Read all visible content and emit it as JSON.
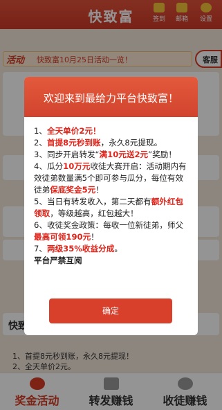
{
  "header": {
    "title": "快致富",
    "sign_label": "签到",
    "mail_label": "邮箱",
    "settings_label": "设置"
  },
  "notice": {
    "tag": "活动",
    "text": "快致富10月25日活动一览！",
    "side_button": "客服"
  },
  "modal": {
    "title": "欢迎来到最给力平台快致富！",
    "items": [
      {
        "prefix": "1、",
        "red": "全天单价2元！",
        "rest": ""
      },
      {
        "prefix": "2、",
        "red": "首提8元秒到账",
        "rest": "，永久8元提现。"
      },
      {
        "prefix": "3、同步开启转发“",
        "red": "满10元送2元",
        "rest": "”奖励！"
      },
      {
        "prefix": "4、瓜分",
        "red": "10万元",
        "rest": "收徒大赛开启：活动期内有效徒弟数量满5个即可参与瓜分，每位有效徒弟"
      },
      {
        "prefix": "5、当日有转发收入，第二天都有",
        "red": "额外红包领取",
        "rest": "，等级越高，红包越大！"
      },
      {
        "prefix": "6、收徒奖金政策：每收一位新徒弟，师父",
        "red": "最高可领190元",
        "rest": "！"
      },
      {
        "prefix": "7、",
        "red": "两级35%收益分成",
        "rest": "。"
      }
    ],
    "item4_tail_red": "保底奖金5元",
    "item4_tail": "！",
    "footer_note": "平台严禁互阅",
    "confirm_label": "确定"
  },
  "bottom": {
    "section_label": "快致富",
    "lines": [
      "1、首提8元秒到账，永久8元提现！",
      "2、全天单价2元。"
    ]
  },
  "tabs": [
    {
      "label": "奖金活动"
    },
    {
      "label": "转发赚钱"
    },
    {
      "label": "收徒赚钱"
    }
  ],
  "colors": {
    "accent": "#d83b23",
    "highlight": "#e0241a"
  }
}
